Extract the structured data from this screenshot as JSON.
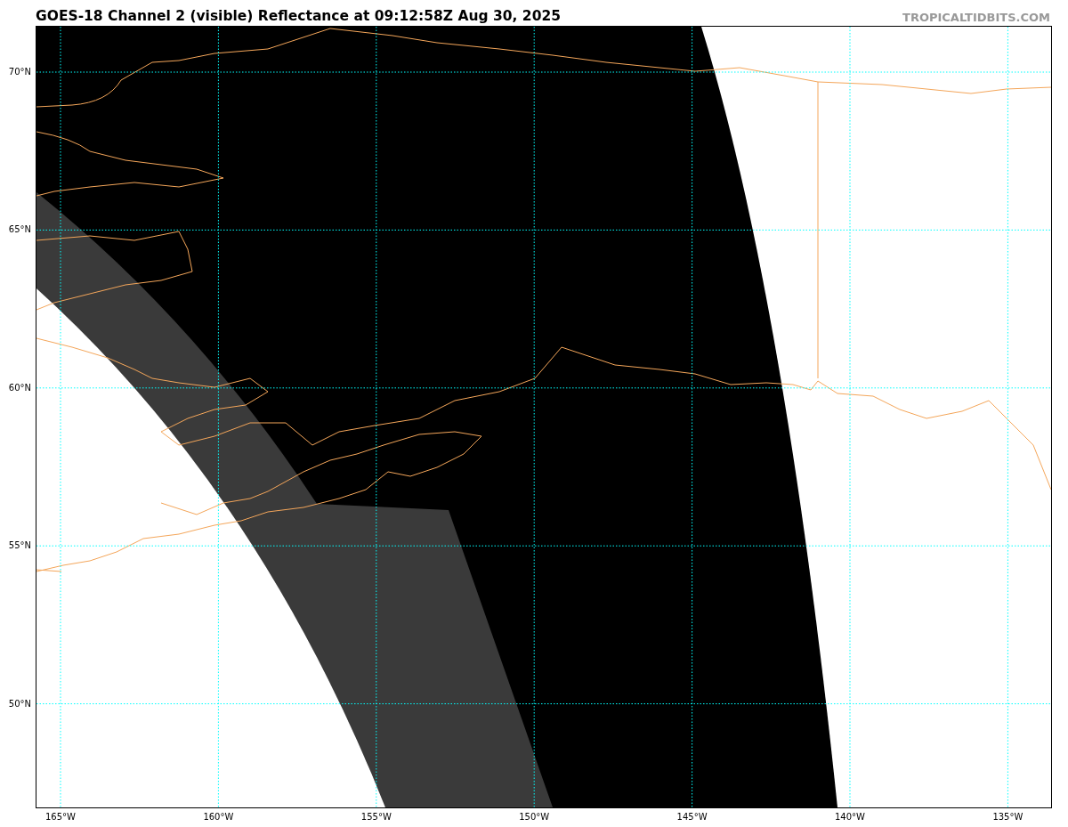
{
  "title": "GOES-18 Channel 2 (visible) Reflectance at 09:12:58Z Aug 30, 2025",
  "site_label": "TROPICALTIDBITS.COM",
  "map": {
    "lat_labels": [
      "70°N",
      "65°N",
      "60°N",
      "55°N",
      "50°N"
    ],
    "lon_labels": [
      "165°W",
      "160°W",
      "155°W",
      "150°W",
      "145°W",
      "140°W",
      "135°W"
    ]
  }
}
